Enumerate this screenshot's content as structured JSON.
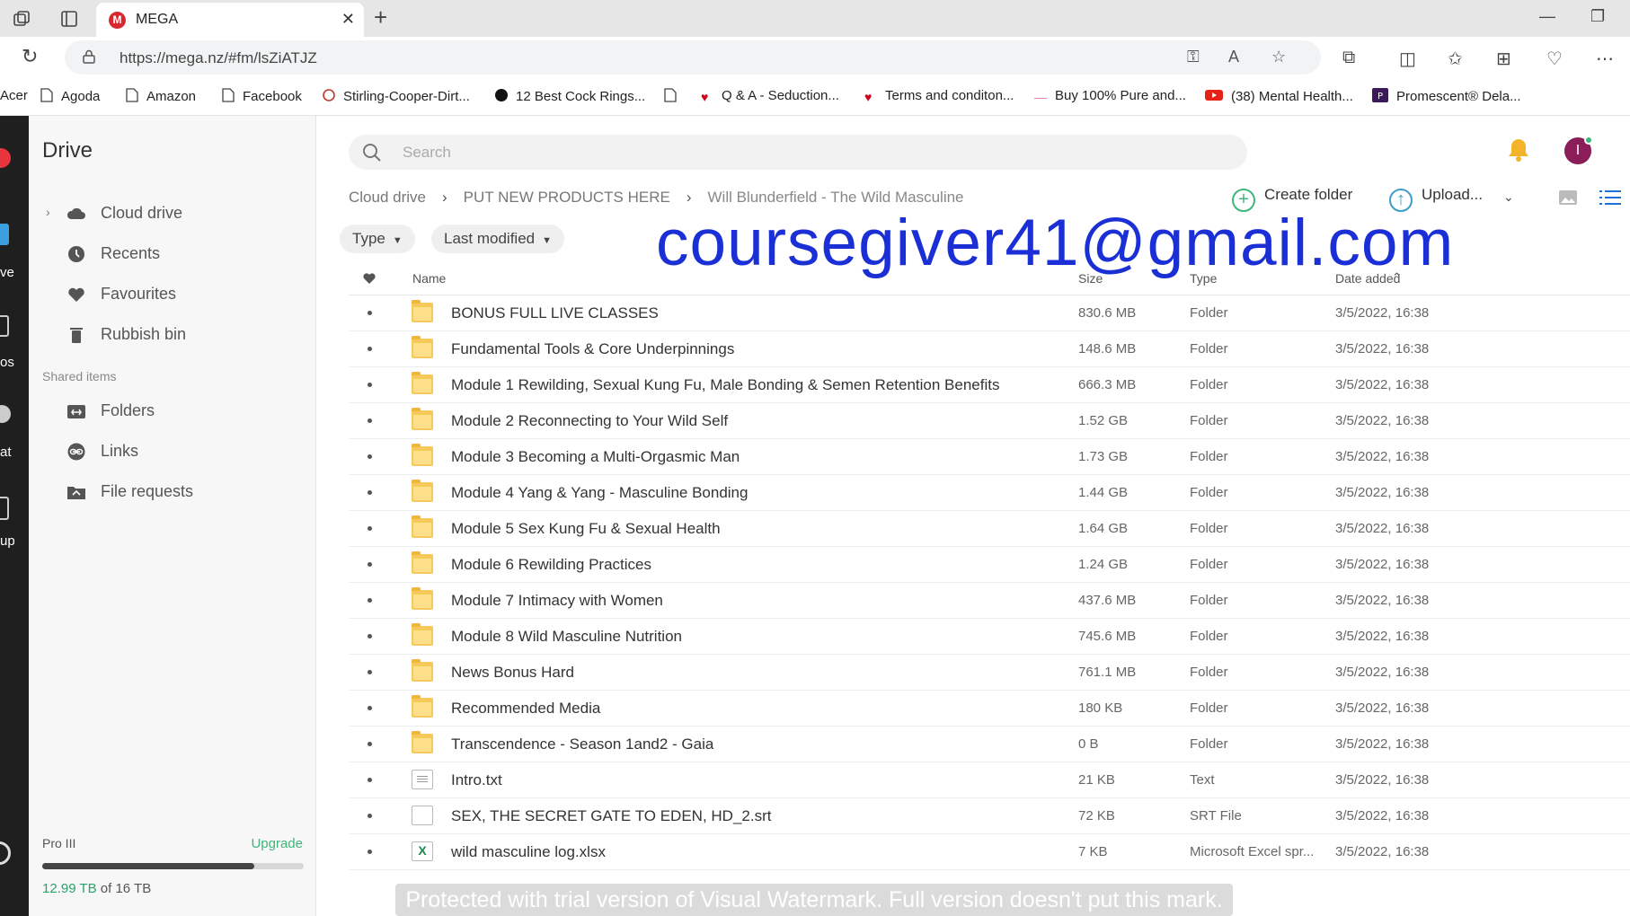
{
  "browser": {
    "tab_title": "MEGA",
    "tab_favicon_letter": "M",
    "url": "https://mega.nz/#fm/lsZiATJZ"
  },
  "bookmarks": [
    {
      "label": "Acer"
    },
    {
      "label": "Agoda"
    },
    {
      "label": "Amazon"
    },
    {
      "label": "Facebook"
    },
    {
      "label": "Stirling-Cooper-Dirt..."
    },
    {
      "label": "12 Best Cock Rings..."
    },
    {
      "label": ""
    },
    {
      "label": "Q & A - Seduction..."
    },
    {
      "label": "Terms and conditon..."
    },
    {
      "label": "Buy 100% Pure and..."
    },
    {
      "label": "(38) Mental Health..."
    },
    {
      "label": "Promescent® Dela..."
    }
  ],
  "rail": [
    "ve",
    "os",
    "at",
    "up"
  ],
  "sidebar": {
    "title": "Drive",
    "items": [
      {
        "label": "Cloud drive",
        "icon": "cloud-icon"
      },
      {
        "label": "Recents",
        "icon": "clock-icon"
      },
      {
        "label": "Favourites",
        "icon": "heart-icon"
      },
      {
        "label": "Rubbish bin",
        "icon": "trash-icon"
      }
    ],
    "shared_heading": "Shared items",
    "shared_items": [
      {
        "label": "Folders",
        "icon": "shared-folder-icon"
      },
      {
        "label": "Links",
        "icon": "link-icon"
      },
      {
        "label": "File requests",
        "icon": "file-request-icon"
      }
    ],
    "plan": "Pro III",
    "upgrade": "Upgrade",
    "storage_used": "12.99 TB",
    "storage_rest": " of 16 TB",
    "storage_fraction": 0.812
  },
  "main": {
    "search_placeholder": "Search",
    "breadcrumbs": [
      "Cloud drive",
      "PUT NEW PRODUCTS HERE",
      "Will Blunderfield - The Wild Masculine"
    ],
    "create_folder": "Create folder",
    "upload": "Upload...",
    "filters": [
      "Type",
      "Last modified"
    ],
    "columns": {
      "name": "Name",
      "size": "Size",
      "type": "Type",
      "date": "Date added"
    },
    "overlay_email": "coursegiver41@gmail.com",
    "files": [
      {
        "name": "BONUS FULL LIVE CLASSES",
        "size": "830.6 MB",
        "type": "Folder",
        "date": "3/5/2022, 16:38",
        "kind": "folder"
      },
      {
        "name": "Fundamental Tools & Core Underpinnings",
        "size": "148.6 MB",
        "type": "Folder",
        "date": "3/5/2022, 16:38",
        "kind": "folder"
      },
      {
        "name": "Module 1 Rewilding, Sexual Kung Fu, Male Bonding & Semen Retention Benefits",
        "size": "666.3 MB",
        "type": "Folder",
        "date": "3/5/2022, 16:38",
        "kind": "folder"
      },
      {
        "name": "Module 2 Reconnecting to Your Wild Self",
        "size": "1.52 GB",
        "type": "Folder",
        "date": "3/5/2022, 16:38",
        "kind": "folder"
      },
      {
        "name": "Module 3 Becoming a Multi-Orgasmic Man",
        "size": "1.73 GB",
        "type": "Folder",
        "date": "3/5/2022, 16:38",
        "kind": "folder"
      },
      {
        "name": "Module 4 Yang & Yang - Masculine Bonding",
        "size": "1.44 GB",
        "type": "Folder",
        "date": "3/5/2022, 16:38",
        "kind": "folder"
      },
      {
        "name": "Module 5 Sex Kung Fu & Sexual Health",
        "size": "1.64 GB",
        "type": "Folder",
        "date": "3/5/2022, 16:38",
        "kind": "folder"
      },
      {
        "name": "Module 6 Rewilding Practices",
        "size": "1.24 GB",
        "type": "Folder",
        "date": "3/5/2022, 16:38",
        "kind": "folder"
      },
      {
        "name": "Module 7 Intimacy with Women",
        "size": "437.6 MB",
        "type": "Folder",
        "date": "3/5/2022, 16:38",
        "kind": "folder"
      },
      {
        "name": "Module 8 Wild Masculine Nutrition",
        "size": "745.6 MB",
        "type": "Folder",
        "date": "3/5/2022, 16:38",
        "kind": "folder"
      },
      {
        "name": "News Bonus Hard",
        "size": "761.1 MB",
        "type": "Folder",
        "date": "3/5/2022, 16:38",
        "kind": "folder"
      },
      {
        "name": "Recommended Media",
        "size": "180 KB",
        "type": "Folder",
        "date": "3/5/2022, 16:38",
        "kind": "folder"
      },
      {
        "name": "Transcendence - Season 1and2 - Gaia",
        "size": "0 B",
        "type": "Folder",
        "date": "3/5/2022, 16:38",
        "kind": "folder"
      },
      {
        "name": "Intro.txt",
        "size": "21 KB",
        "type": "Text",
        "date": "3/5/2022, 16:38",
        "kind": "text"
      },
      {
        "name": "SEX, THE SECRET GATE TO EDEN, HD_2.srt",
        "size": "72 KB",
        "type": "SRT File",
        "date": "3/5/2022, 16:38",
        "kind": "file"
      },
      {
        "name": "wild masculine log.xlsx",
        "size": "7 KB",
        "type": "Microsoft Excel spr...",
        "date": "3/5/2022, 16:38",
        "kind": "xlsx"
      }
    ]
  },
  "trial_watermark": "Protected with trial version of Visual Watermark. Full version doesn't put this mark."
}
